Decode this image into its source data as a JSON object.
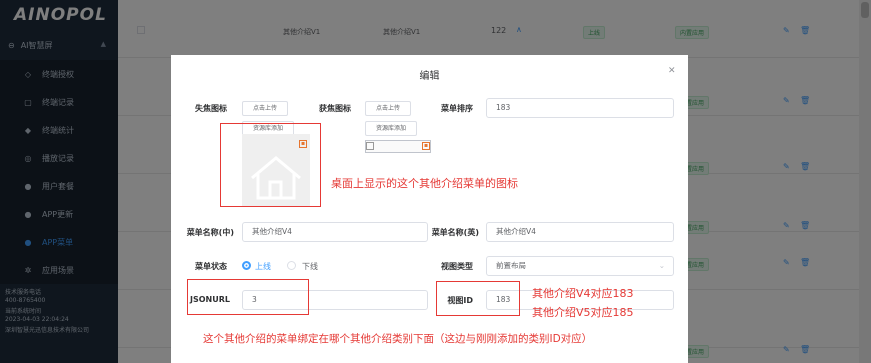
{
  "sidebar": {
    "logo": "AINOPOL",
    "group": "AI智慧屏",
    "items": [
      {
        "label": "终端授权",
        "icon": "shield-icon"
      },
      {
        "label": "终端记录",
        "icon": "record-icon"
      },
      {
        "label": "终端统计",
        "icon": "stats-icon"
      },
      {
        "label": "播放记录",
        "icon": "play-record-icon"
      },
      {
        "label": "用户套餐",
        "icon": "package-icon"
      },
      {
        "label": "APP更新",
        "icon": "update-icon"
      },
      {
        "label": "APP菜单",
        "icon": "menu-icon"
      },
      {
        "label": "应用场景",
        "icon": "scene-icon"
      }
    ],
    "footer": {
      "hotline_label": "技术服务电话",
      "hotline": "400-8765400",
      "time_label": "当前系统时间",
      "time": "2023-04-03 22:04:24",
      "company": "深圳智慧光迅信息技术有限公司"
    }
  },
  "table": {
    "first_row": {
      "name_cn": "其他介绍V1",
      "name_en": "其他介绍V1",
      "sort": "122",
      "status": "上线",
      "scene": "内置应用"
    },
    "scene_tag": "内置应用"
  },
  "dialog": {
    "title": "编辑",
    "focus_icon_label": "失焦图标",
    "get_focus_label": "获焦图标",
    "upload_btn": "点击上传",
    "resource_btn": "资源库添加",
    "sort_label": "菜单排序",
    "sort_value": "183",
    "name_cn_label": "菜单名称(中)",
    "name_cn_value": "其他介绍V4",
    "name_en_label": "菜单名称(英)",
    "name_en_value": "其他介绍V4",
    "status_label": "菜单状态",
    "status_on": "上线",
    "status_off": "下线",
    "view_type_label": "视图类型",
    "view_type_value": "前置布局",
    "jsonurl_label": "JSONURL",
    "jsonurl_value": "3",
    "view_id_label": "视图ID",
    "view_id_value": "183"
  },
  "annotations": {
    "icon_note": "桌面上显示的这个其他介绍菜单的图标",
    "v4_note": "其他介绍V4对应183",
    "v5_note": "其他介绍V5对应185",
    "bottom_note": "这个其他介绍的菜单绑定在哪个其他介绍类别下面（这边与刚刚添加的类别ID对应）"
  },
  "colors": {
    "accent": "#409eff",
    "annotation": "#e53935",
    "sidebar_bg": "#1f2d3d"
  }
}
